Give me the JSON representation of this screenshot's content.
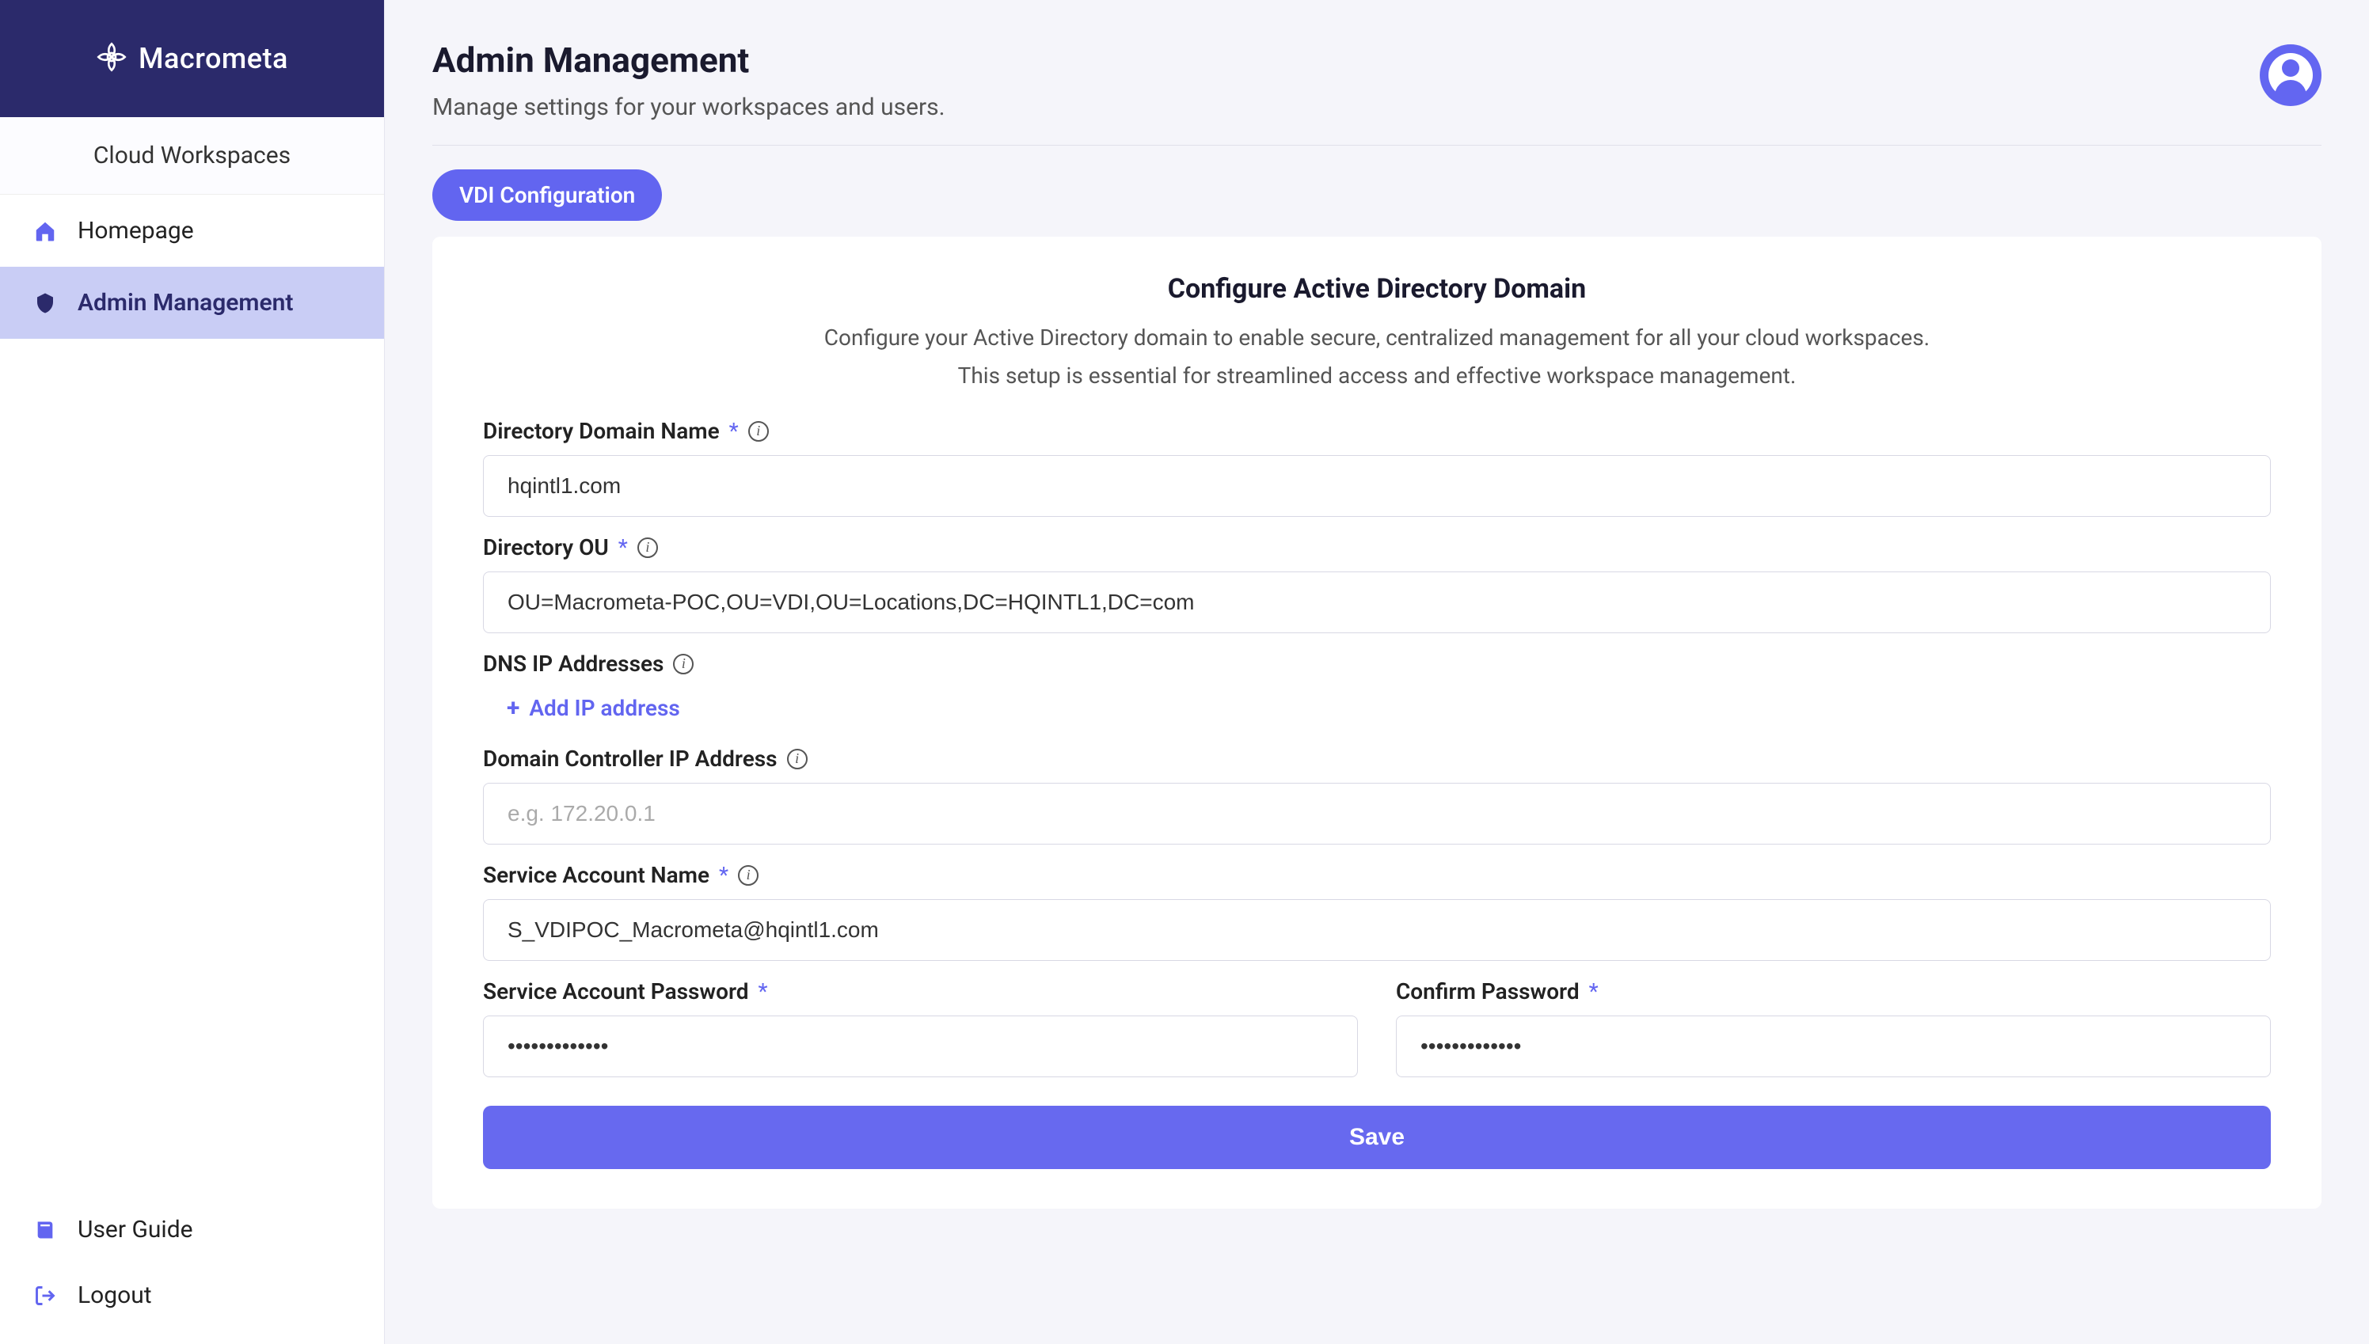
{
  "brand": {
    "name": "Macrometa",
    "subtitle": "Cloud Workspaces"
  },
  "sidebar": {
    "items": [
      {
        "label": "Homepage",
        "icon": "home"
      },
      {
        "label": "Admin Management",
        "icon": "admin"
      }
    ],
    "bottom": [
      {
        "label": "User Guide",
        "icon": "guide"
      },
      {
        "label": "Logout",
        "icon": "logout"
      }
    ]
  },
  "header": {
    "title": "Admin Management",
    "subtitle": "Manage settings for your workspaces and users."
  },
  "tab": {
    "label": "VDI Configuration"
  },
  "card": {
    "title": "Configure Active Directory Domain",
    "desc_line1": "Configure your Active Directory domain to enable secure, centralized management for all your cloud workspaces.",
    "desc_line2": "This setup is essential for streamlined access and effective workspace management."
  },
  "form": {
    "domain_name": {
      "label": "Directory Domain Name",
      "value": "hqintl1.com"
    },
    "directory_ou": {
      "label": "Directory OU",
      "value": "OU=Macrometa-POC,OU=VDI,OU=Locations,DC=HQINTL1,DC=com"
    },
    "dns": {
      "label": "DNS IP Addresses",
      "add_label": "Add IP address"
    },
    "domain_controller": {
      "label": "Domain Controller IP Address",
      "placeholder": "e.g. 172.20.0.1",
      "value": ""
    },
    "service_account": {
      "label": "Service Account Name",
      "value": "S_VDIPOC_Macrometa@hqintl1.com"
    },
    "password": {
      "label": "Service Account Password",
      "value": "•••••••••••••"
    },
    "confirm_password": {
      "label": "Confirm Password",
      "value": "•••••••••••••"
    },
    "save_label": "Save"
  }
}
